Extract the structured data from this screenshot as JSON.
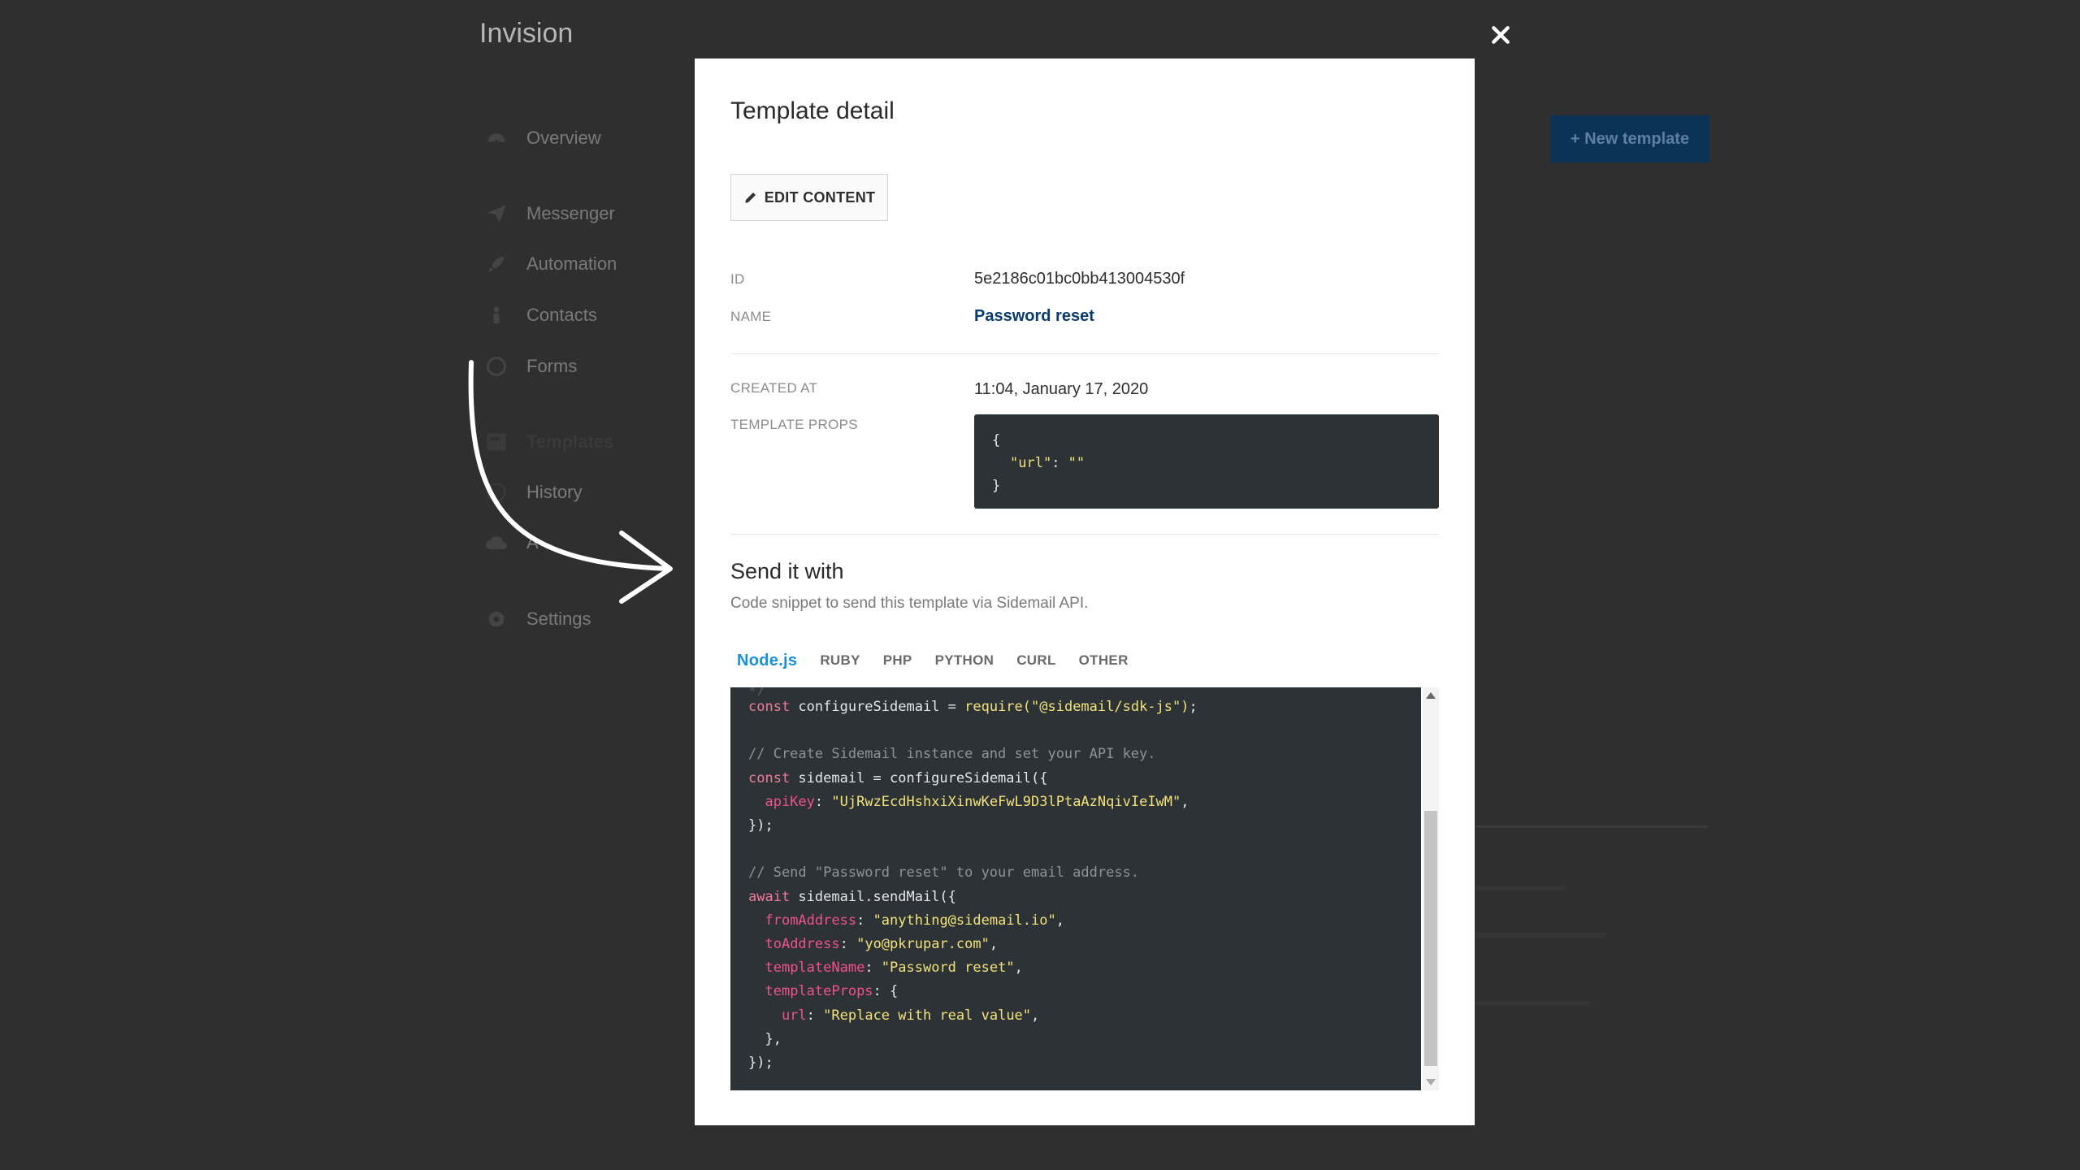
{
  "app": {
    "title": "Invision"
  },
  "sidebar": {
    "items": [
      {
        "label": "Overview",
        "icon": "dashboard-icon"
      },
      {
        "label": "Messenger",
        "icon": "paper-plane-icon"
      },
      {
        "label": "Automation",
        "icon": "rocket-icon"
      },
      {
        "label": "Contacts",
        "icon": "person-icon"
      },
      {
        "label": "Forms",
        "icon": "form-icon"
      },
      {
        "label": "Templates",
        "icon": "template-icon"
      },
      {
        "label": "History",
        "icon": "history-icon"
      },
      {
        "label": "A",
        "icon": "cloud-icon"
      },
      {
        "label": "Settings",
        "icon": "gear-icon"
      }
    ]
  },
  "header": {
    "new_template_label": "+ New template"
  },
  "modal": {
    "title": "Template detail",
    "edit_label": "EDIT CONTENT",
    "fields": {
      "id_label": "ID",
      "id_value": "5e2186c01bc0bb413004530f",
      "name_label": "NAME",
      "name_value": "Password reset",
      "created_label": "CREATED AT",
      "created_value": "11:04, January 17, 2020",
      "props_label": "TEMPLATE PROPS"
    },
    "props_code": {
      "open": "{",
      "key": "\"url\"",
      "colon": ": ",
      "value": "\"\"",
      "close": "}"
    },
    "send": {
      "title": "Send it with",
      "subtitle": "Code snippet to send this template via Sidemail API."
    },
    "tabs": [
      "Node.js",
      "RUBY",
      "PHP",
      "PYTHON",
      "CURL",
      "OTHER"
    ],
    "active_tab": "Node.js",
    "code": {
      "line_hidden": "*/",
      "l1_kw": "const",
      "l1_var": " configureSidemail = ",
      "l1_fn": "require",
      "l1_str": "(\"@sidemail/sdk-js\")",
      "l1_end": ";",
      "comment1": "// Create Sidemail instance and set your API key.",
      "l2_kw": "const",
      "l2_rest": " sidemail = configureSidemail({",
      "l3_key": "apiKey",
      "l3_val": "\"UjRwzEcdHshxiXinwKeFwL9D3lPtaAzNqivIeIwM\"",
      "l4": "});",
      "comment2": "// Send \"Password reset\" to your email address.",
      "l5_kw": "await",
      "l5_rest": " sidemail.sendMail({",
      "l6_key": "fromAddress",
      "l6_val": "\"anything@sidemail.io\"",
      "l7_key": "toAddress",
      "l7_val": "\"yo@pkrupar.com\"",
      "l8_key": "templateName",
      "l8_val": "\"Password reset\"",
      "l9_key": "templateProps",
      "l9_rest": ": {",
      "l10_key": "url",
      "l10_val": "\"Replace with real value\"",
      "l11": "},",
      "l12": "});"
    }
  },
  "colors": {
    "backdrop": "#2f2f2f",
    "accent_link": "#0b3b6b",
    "active_tab": "#1a8fd8",
    "code_bg": "#2c3235"
  }
}
